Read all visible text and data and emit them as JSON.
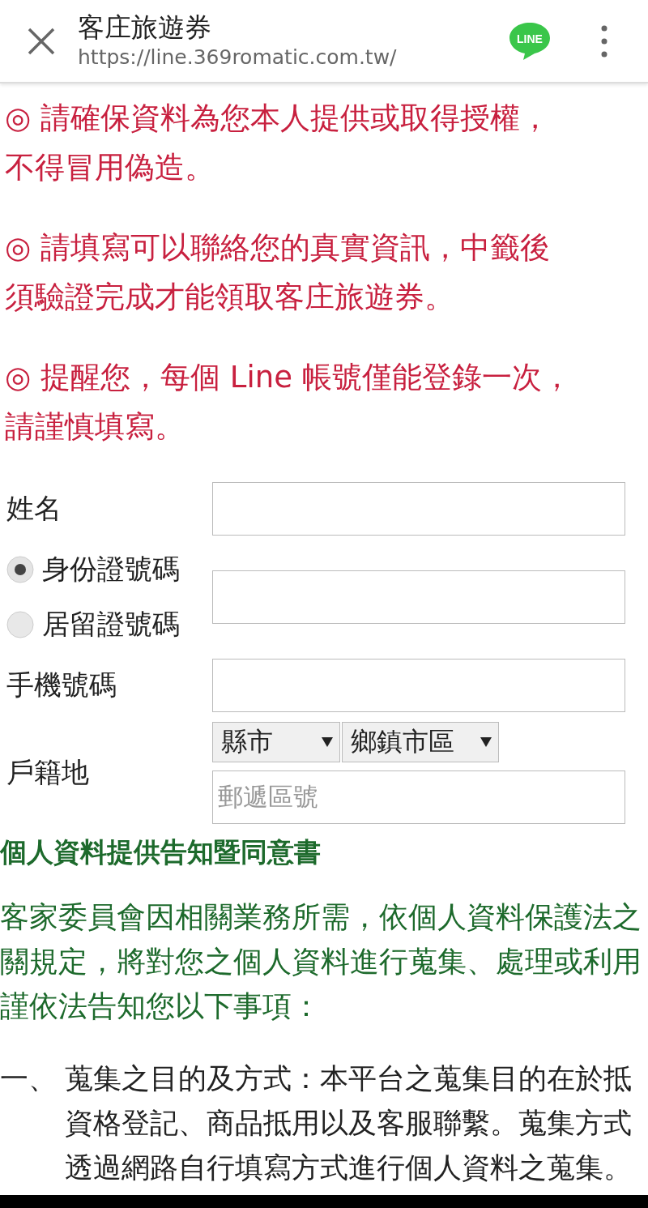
{
  "header": {
    "title": "客庄旅遊券",
    "url": "https://line.369romatic.com.tw/",
    "logo_text": "LINE"
  },
  "notices": [
    [
      "◎ 請確保資料為您本人提供或取得授權，",
      "不得冒用偽造。"
    ],
    [
      "◎ 請填寫可以聯絡您的真實資訊，中籤後",
      "須驗證完成才能領取客庄旅遊券。"
    ],
    [
      "◎ 提醒您，每個 Line 帳號僅能登錄一次，",
      "請謹慎填寫。"
    ]
  ],
  "form": [
    {
      "kind": "text",
      "label": "姓名"
    },
    {
      "kind": "radio",
      "options": [
        {
          "label": "身份證號碼",
          "selected": true
        },
        {
          "label": "居留證號碼",
          "selected": false
        }
      ]
    },
    {
      "kind": "text",
      "label": "手機號碼"
    },
    {
      "kind": "address",
      "label": "戶籍地",
      "selects": [
        "縣市",
        "鄉鎮市區"
      ],
      "placeholder": "郵遞區號"
    }
  ],
  "consent": {
    "title": "個人資料提供告知暨同意書",
    "lines": [
      "客家委員會因相關業務所需，依個人資料保護法之",
      "關規定，將對您之個人資料進行蒐集、處理或利用",
      "謹依法告知您以下事項："
    ],
    "items": [
      {
        "marker": "一、",
        "lines": [
          "蒐集之目的及方式：本平台之蒐集目的在於抵",
          "資格登記、商品抵用以及客服聯繫。蒐集方式",
          "透過網路自行填寫方式進行個人資料之蒐集。"
        ]
      }
    ]
  }
}
